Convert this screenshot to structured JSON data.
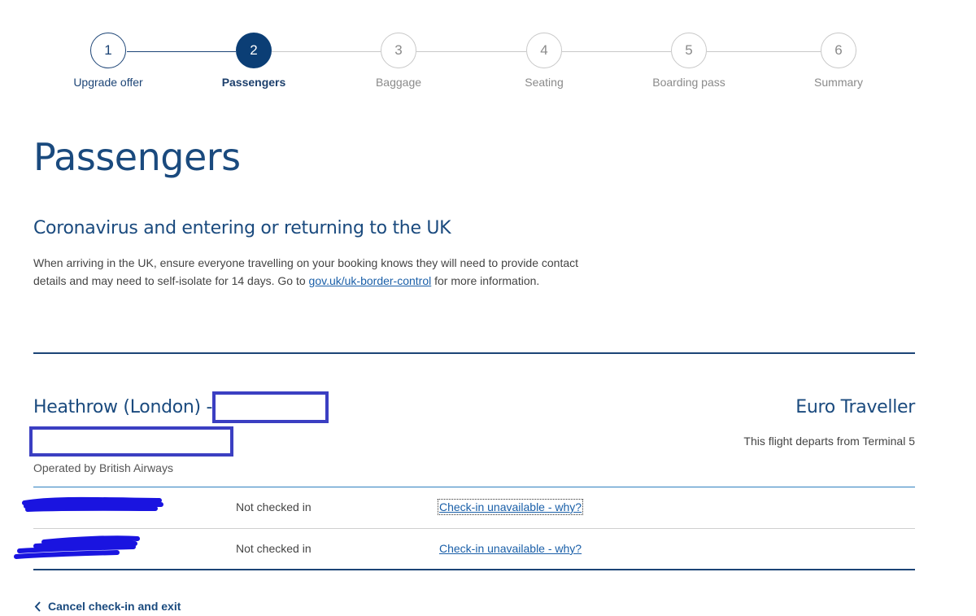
{
  "stepper": {
    "steps": [
      {
        "number": "1",
        "label": "Upgrade offer",
        "state": "completed"
      },
      {
        "number": "2",
        "label": "Passengers",
        "state": "active"
      },
      {
        "number": "3",
        "label": "Baggage",
        "state": "upcoming"
      },
      {
        "number": "4",
        "label": "Seating",
        "state": "upcoming"
      },
      {
        "number": "5",
        "label": "Boarding pass",
        "state": "upcoming"
      },
      {
        "number": "6",
        "label": "Summary",
        "state": "upcoming"
      }
    ]
  },
  "page": {
    "title": "Passengers"
  },
  "notice": {
    "title": "Coronavirus and entering or returning to the UK",
    "text_before_link": "When arriving in the UK, ensure everyone travelling on your booking knows they will need to provide contact details and may need to self-isolate for 14 days. Go to ",
    "link_text": "gov.uk/uk-border-control",
    "text_after_link": " for more information."
  },
  "flight": {
    "route": "Heathrow (London) -",
    "cabin": "Euro Traveller",
    "terminal": "This flight departs from Terminal 5",
    "operator": "Operated by British Airways"
  },
  "passengers": [
    {
      "status": "Not checked in",
      "action": "Check-in unavailable - why?"
    },
    {
      "status": "Not checked in",
      "action": "Check-in unavailable - why?"
    }
  ],
  "footer": {
    "cancel_label": "Cancel check-in and exit"
  },
  "colors": {
    "brand_blue": "#1a4a7e",
    "active_step": "#0b3e75",
    "link_blue": "#1a5fa8",
    "redaction_box": "#3b3fc2",
    "redaction_scribble": "#1a14e0"
  }
}
